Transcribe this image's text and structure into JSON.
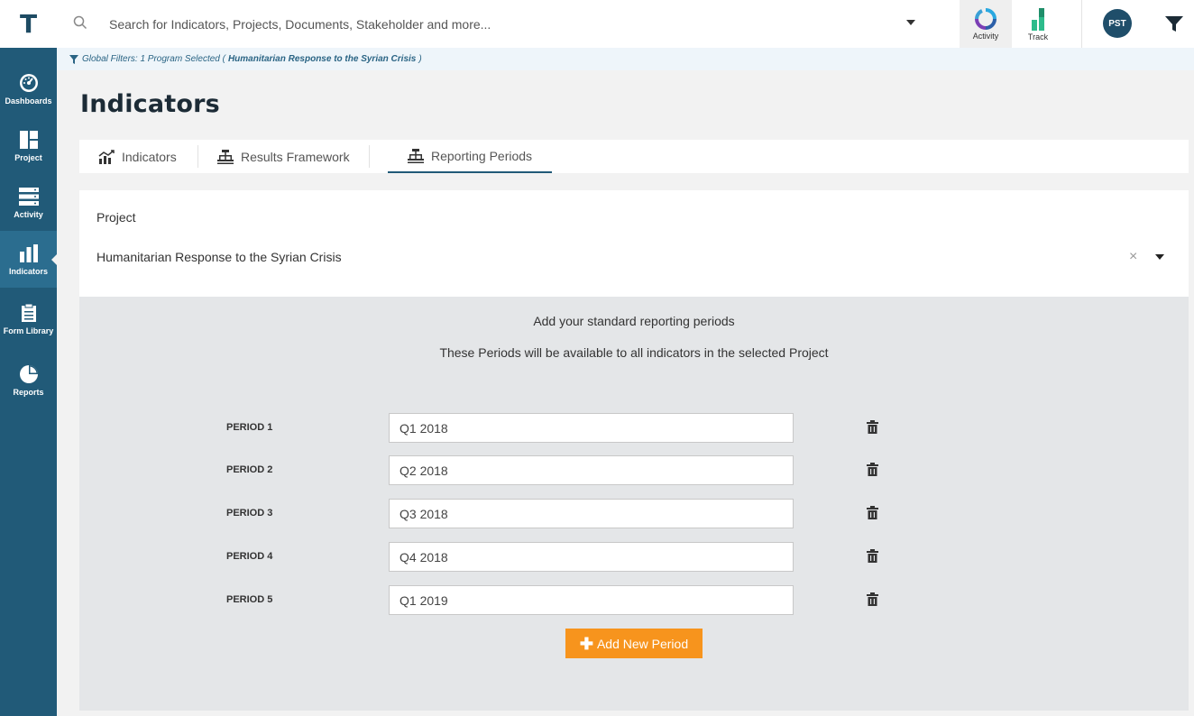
{
  "app": {
    "logo_letter": "T"
  },
  "sidebar": {
    "items": [
      {
        "label": "Dashboards",
        "icon": "dashboard-gauge-icon"
      },
      {
        "label": "Project",
        "icon": "project-grid-icon"
      },
      {
        "label": "Activity",
        "icon": "activity-list-icon"
      },
      {
        "label": "Indicators",
        "icon": "bar-chart-icon",
        "active": true
      },
      {
        "label": "Form Library",
        "icon": "clipboard-icon"
      },
      {
        "label": "Reports",
        "icon": "pie-chart-icon"
      }
    ]
  },
  "header": {
    "search_placeholder": "Search for Indicators, Projects, Documents, Stakeholder and more...",
    "activity_label": "Activity",
    "track_label": "Track",
    "avatar_initials": "PST"
  },
  "global_filter": {
    "prefix": "Global Filters: 1 Program Selected (",
    "program": "Humanitarian Response to the Syrian Crisis",
    "suffix": ")"
  },
  "page": {
    "title": "Indicators",
    "tabs": [
      {
        "label": "Indicators",
        "icon": "line-chart-icon"
      },
      {
        "label": "Results Framework",
        "icon": "hierarchy-icon"
      },
      {
        "label": "Reporting Periods",
        "icon": "hierarchy-icon",
        "active": true
      }
    ]
  },
  "project": {
    "label": "Project",
    "value": "Humanitarian Response to the Syrian Crisis",
    "clear_symbol": "×"
  },
  "periods": {
    "intro_title": "Add your standard reporting periods",
    "intro_subtitle": "These Periods will be available to all indicators in the selected Project",
    "rows": [
      {
        "label": "PERIOD 1",
        "value": "Q1 2018"
      },
      {
        "label": "PERIOD 2",
        "value": "Q2 2018"
      },
      {
        "label": "PERIOD 3",
        "value": "Q3 2018"
      },
      {
        "label": "PERIOD 4",
        "value": "Q4 2018"
      },
      {
        "label": "PERIOD 5",
        "value": "Q1 2019"
      }
    ],
    "add_button_label": "Add New Period"
  },
  "colors": {
    "sidebar": "#215a78",
    "accent_orange": "#f7941d",
    "panel_gray": "#e4e6e8",
    "title_dark": "#1c2b36"
  }
}
